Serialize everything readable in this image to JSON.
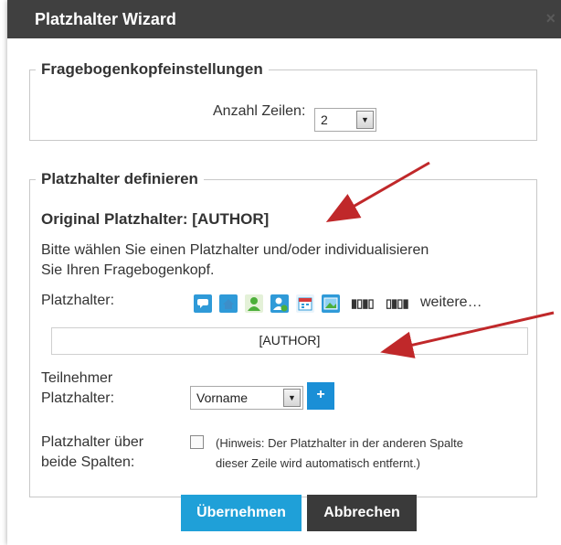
{
  "dialog": {
    "title": "Platzhalter Wizard",
    "close": "×"
  },
  "header_settings": {
    "legend": "Fragebogenkopfeinstellungen",
    "rows_label": "Anzahl Zeilen:",
    "rows_value": "2"
  },
  "placeholder": {
    "legend": "Platzhalter definieren",
    "original": "Original Platzhalter: [AUTHOR]",
    "instruction_line1": "Bitte wählen Sie einen Platzhalter und/oder individualisieren",
    "instruction_line2": "Sie Ihren Fragebogenkopf.",
    "icons_label": "Platzhalter:",
    "icon_bars_1": "▮▯▮▯",
    "icon_bars_2": "▯▮▯▮",
    "more_link": "weitere…",
    "input_value": "[AUTHOR]",
    "participant_label_1": "Teilnehmer",
    "participant_label_2": "Platzhalter:",
    "participant_select": "Vorname",
    "add_label": "+",
    "span_label_1": "Platzhalter über",
    "span_label_2": "beide Spalten:",
    "hint_line1": "(Hinweis: Der Platzhalter in der anderen Spalte",
    "hint_line2": "dieser Zeile wird automatisch entfernt.)"
  },
  "buttons": {
    "apply": "Übernehmen",
    "cancel": "Abbrechen"
  },
  "colors": {
    "titlebar": "#404040",
    "apply": "#1fa0d8",
    "cancel": "#3a3a3a",
    "accent": "#1a8fd6",
    "arrow": "#c0282a"
  }
}
